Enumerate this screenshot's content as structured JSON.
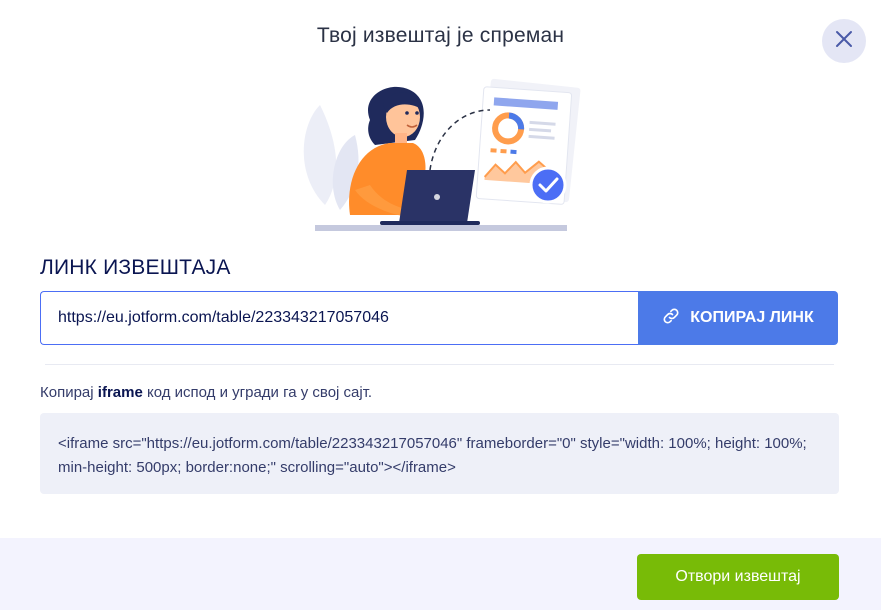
{
  "modal": {
    "title": "Твој извештај је спреман"
  },
  "illustration": {
    "icons": [
      "report-ready-illustration",
      "check-badge-icon"
    ]
  },
  "link_section": {
    "heading": "ЛИНК ИЗВЕШТАЈА",
    "url": "https://eu.jotform.com/table/223343217057046",
    "copy_label": "КОПИРАЈ ЛИНК",
    "copy_icon": "link-icon"
  },
  "embed_section": {
    "instruction_prefix": "Копирај ",
    "instruction_bold": "iframe",
    "instruction_suffix": " код испод и угради га у свој сајт.",
    "code": "<iframe src=\"https://eu.jotform.com/table/223343217057046\" frameborder=\"0\" style=\"width: 100%; height: 100%; min-height: 500px; border:none;\" scrolling=\"auto\"></iframe>"
  },
  "footer": {
    "open_label": "Отвори извештај"
  },
  "colors": {
    "accent_blue": "#4c7ae8",
    "accent_green": "#78bb07",
    "heading_navy": "#0a1551",
    "close_bg": "#e4e6f5",
    "code_bg": "#eef0f8",
    "footer_bg": "#f3f3fe"
  }
}
